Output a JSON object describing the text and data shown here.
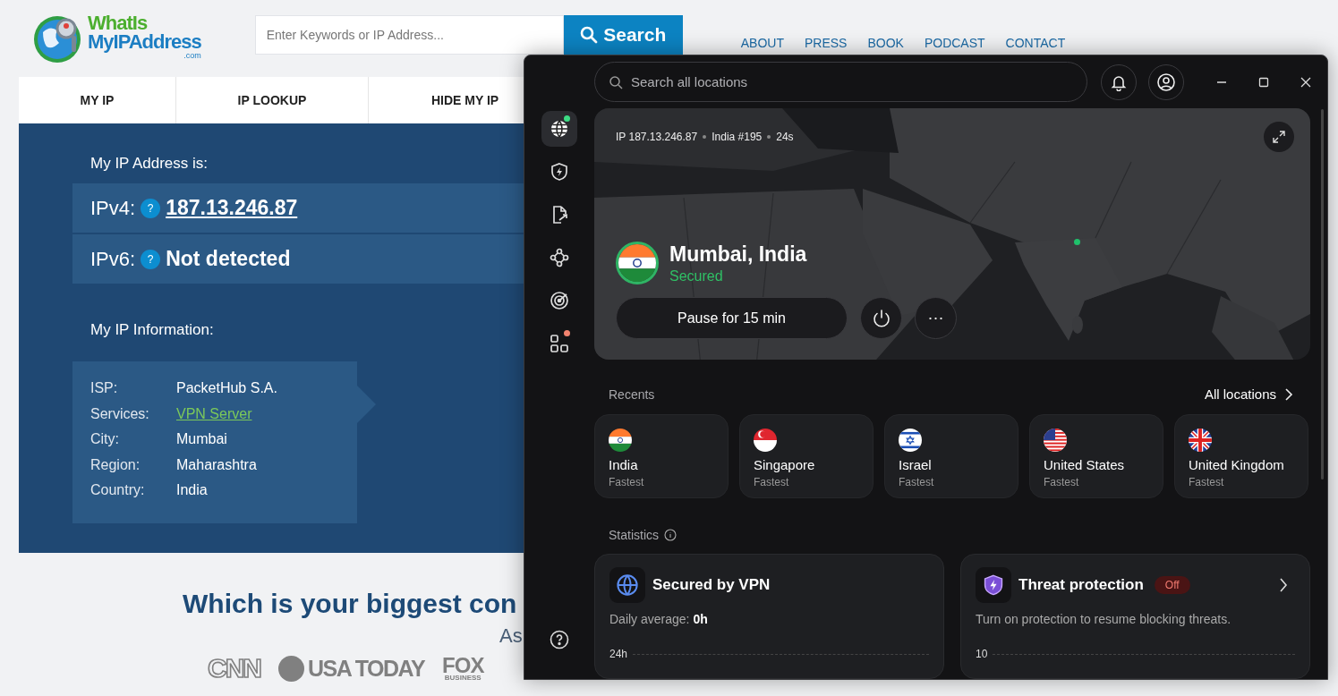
{
  "website": {
    "logo": {
      "line1": "WhatIs",
      "line2": "MyIPAddress",
      "line3": ".com"
    },
    "search": {
      "placeholder": "Enter Keywords or IP Address...",
      "button": "Search"
    },
    "top_links": [
      "ABOUT",
      "PRESS",
      "BOOK",
      "PODCAST",
      "CONTACT"
    ],
    "nav": [
      "MY IP",
      "IP LOOKUP",
      "HIDE MY IP"
    ],
    "ip_heading": "My IP Address is:",
    "ip_rows": [
      {
        "label": "IPv4:",
        "help": "?",
        "value": "187.13.246.87",
        "kind": "link"
      },
      {
        "label": "IPv6:",
        "help": "?",
        "value": "Not detected",
        "kind": "text"
      }
    ],
    "info_heading": "My IP Information:",
    "info": [
      {
        "label": "ISP:",
        "value": "PacketHub S.A.",
        "kind": "text"
      },
      {
        "label": "Services:",
        "value": "VPN Server",
        "kind": "link"
      },
      {
        "label": "City:",
        "value": "Mumbai",
        "kind": "text"
      },
      {
        "label": "Region:",
        "value": "Maharashtra",
        "kind": "text"
      },
      {
        "label": "Country:",
        "value": "India",
        "kind": "text"
      }
    ],
    "headline": "Which is your biggest con",
    "subline": "As",
    "press": [
      {
        "kind": "cnn",
        "text": "CNN"
      },
      {
        "kind": "usatoday",
        "text": "USA TODAY"
      },
      {
        "kind": "fox",
        "text": "FOX",
        "subtext": "BUSINESS"
      }
    ]
  },
  "vpn": {
    "search": {
      "placeholder": "Search all locations"
    },
    "sidebar": [
      {
        "kind": "globe",
        "selected": true,
        "color": "#3ddc84"
      },
      {
        "kind": "shield",
        "selected": false
      },
      {
        "kind": "export",
        "selected": false
      },
      {
        "kind": "nodes",
        "selected": false
      },
      {
        "kind": "target",
        "selected": false
      },
      {
        "kind": "apps",
        "selected": false,
        "color": "#f2836f"
      }
    ],
    "connection": {
      "ip": "IP 187.13.246.87",
      "server": "India #195",
      "time": "24s",
      "flag": {
        "kind": "india"
      },
      "location": "Mumbai, India",
      "status": "Secured",
      "connected": true,
      "pause": "Pause for 15 min",
      "more": "···"
    },
    "recents_label": "Recents",
    "all_locations": "All locations",
    "recents": [
      {
        "kind": "india",
        "name": "India",
        "sub": "Fastest"
      },
      {
        "kind": "singapore",
        "name": "Singapore",
        "sub": "Fastest"
      },
      {
        "kind": "israel",
        "name": "Israel",
        "sub": "Fastest"
      },
      {
        "kind": "us",
        "name": "United States",
        "sub": "Fastest"
      },
      {
        "kind": "uk",
        "name": "United Kingdom",
        "sub": "Fastest"
      }
    ],
    "statistics_label": "Statistics",
    "stats": [
      {
        "kind": "vpn",
        "title": "Secured by VPN",
        "line": "Daily average: **0h**",
        "axis": "24h"
      },
      {
        "kind": "threat",
        "title": "Threat protection",
        "status": "Off",
        "line": "Turn on protection to resume blocking threats.",
        "axis": "10"
      }
    ]
  }
}
